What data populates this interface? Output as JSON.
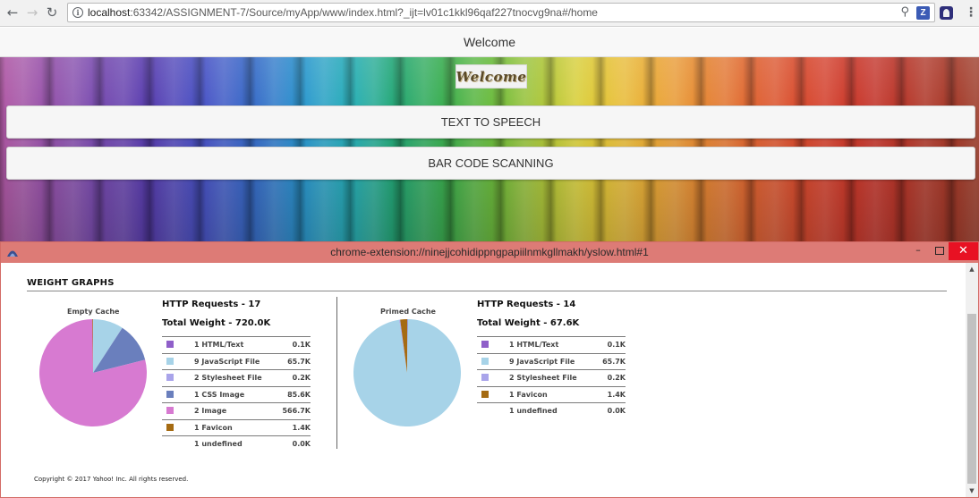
{
  "browser": {
    "url_host": "localhost",
    "url_rest": ":63342/ASSIGNMENT-7/Source/myApp/www/index.html?_ijt=lv01c1kkl96qaf227tnocvg9na#/home",
    "ext_z_label": "Z",
    "icons": [
      "back-arrow-icon",
      "forward-arrow-icon",
      "reload-icon",
      "info-icon",
      "key-icon",
      "star-icon",
      "menu-dots-icon"
    ]
  },
  "app": {
    "header_title": "Welcome",
    "logo_text": "Welcome",
    "buttons": [
      {
        "label": "TEXT TO SPEECH"
      },
      {
        "label": "BAR CODE SCANNING"
      }
    ]
  },
  "popup": {
    "title": "chrome-extension://ninejjcohidippngpapiilnmkgllmakh/yslow.html#1",
    "minimize_label": "–",
    "close_label": "✕",
    "colors": {
      "titlebar": "#dd7b76",
      "close": "#e81123"
    }
  },
  "weight_graphs": {
    "heading": "WEIGHT GRAPHS",
    "copyright": "Copyright © 2017 Yahoo! Inc. All rights reserved.",
    "empty": {
      "cache_label": "Empty Cache",
      "requests": "HTTP Requests - 17",
      "total_weight": "Total Weight - 720.0K",
      "rows": [
        {
          "count_label": "1 HTML/Text",
          "size": "0.1K",
          "color": "#8f5fc9"
        },
        {
          "count_label": "9 JavaScript File",
          "size": "65.7K",
          "color": "#a7d3e8"
        },
        {
          "count_label": "2 Stylesheet File",
          "size": "0.2K",
          "color": "#a9a4ea"
        },
        {
          "count_label": "1 CSS Image",
          "size": "85.6K",
          "color": "#6a7fbd"
        },
        {
          "count_label": "2 Image",
          "size": "566.7K",
          "color": "#d77ad1"
        },
        {
          "count_label": "1 Favicon",
          "size": "1.4K",
          "color": "#a56b12"
        },
        {
          "count_label": "1 undefined",
          "size": "0.0K",
          "color": ""
        }
      ]
    },
    "primed": {
      "cache_label": "Primed Cache",
      "requests": "HTTP Requests - 14",
      "total_weight": "Total Weight - 67.6K",
      "rows": [
        {
          "count_label": "1 HTML/Text",
          "size": "0.1K",
          "color": "#8f5fc9"
        },
        {
          "count_label": "9 JavaScript File",
          "size": "65.7K",
          "color": "#a7d3e8"
        },
        {
          "count_label": "2 Stylesheet File",
          "size": "0.2K",
          "color": "#a9a4ea"
        },
        {
          "count_label": "1 Favicon",
          "size": "1.4K",
          "color": "#a56b12"
        },
        {
          "count_label": "1 undefined",
          "size": "0.0K",
          "color": ""
        }
      ]
    }
  }
}
